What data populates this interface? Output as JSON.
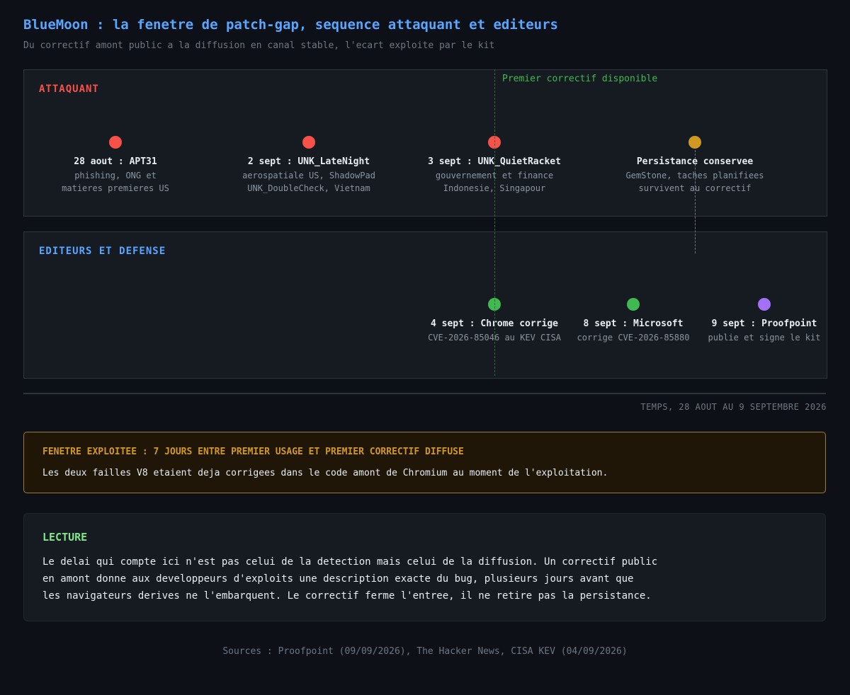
{
  "header": {
    "title": "BlueMoon : la fenetre de patch-gap, sequence attaquant et editeurs",
    "subtitle": "Du correctif amont public a la diffusion en canal stable, l'ecart exploite par le kit"
  },
  "colors": {
    "attacker": "#f85149",
    "defense": "#3fb950",
    "persistence": "#d29922",
    "proofpoint": "#a371f7",
    "accent": "#58a6ff"
  },
  "marker": {
    "label": "Premier correctif disponible"
  },
  "attacker_lane": {
    "title": "ATTAQUANT",
    "events": [
      {
        "title": "28 aout : APT31",
        "desc1": "phishing, ONG et",
        "desc2": "matieres premieres US",
        "color": "#f85149"
      },
      {
        "title": "2 sept : UNK_LateNight",
        "desc1": "aerospatiale US, ShadowPad",
        "desc2": "UNK_DoubleCheck, Vietnam",
        "color": "#f85149"
      },
      {
        "title": "3 sept : UNK_QuietRacket",
        "desc1": "gouvernement et finance",
        "desc2": "Indonesie, Singapour",
        "color": "#f85149"
      },
      {
        "title": "Persistance conservee",
        "desc1": "GemStone, taches planifiees",
        "desc2": "survivent au correctif",
        "color": "#d29922"
      }
    ]
  },
  "defense_lane": {
    "title": "EDITEURS ET DEFENSE",
    "events": [
      {
        "title": "4 sept : Chrome corrige",
        "desc1": "CVE-2026-85046 au KEV CISA",
        "color": "#3fb950"
      },
      {
        "title": "8 sept : Microsoft",
        "desc1": "corrige CVE-2026-85880",
        "color": "#3fb950"
      },
      {
        "title": "9 sept : Proofpoint",
        "desc1": "publie et signe le kit",
        "color": "#a371f7"
      }
    ]
  },
  "axis": {
    "label": "TEMPS, 28 AOUT AU 9 SEPTEMBRE 2026"
  },
  "warning": {
    "title": "FENETRE EXPLOITEE : 7 JOURS ENTRE PREMIER USAGE ET PREMIER CORRECTIF DIFFUSE",
    "body": "Les deux failles V8 etaient deja corrigees dans le code amont de Chromium au moment de l'exploitation."
  },
  "reading": {
    "title": "LECTURE",
    "lines": [
      "Le delai qui compte ici n'est pas celui de la detection mais celui de la diffusion. Un correctif public",
      "en amont donne aux developpeurs d'exploits une description exacte du bug, plusieurs jours avant que",
      "les navigateurs derives ne l'embarquent. Le correctif ferme l'entree, il ne retire pas la persistance."
    ]
  },
  "footer": {
    "sources": "Sources : Proofpoint (09/09/2026), The Hacker News, CISA KEV (04/09/2026)"
  }
}
